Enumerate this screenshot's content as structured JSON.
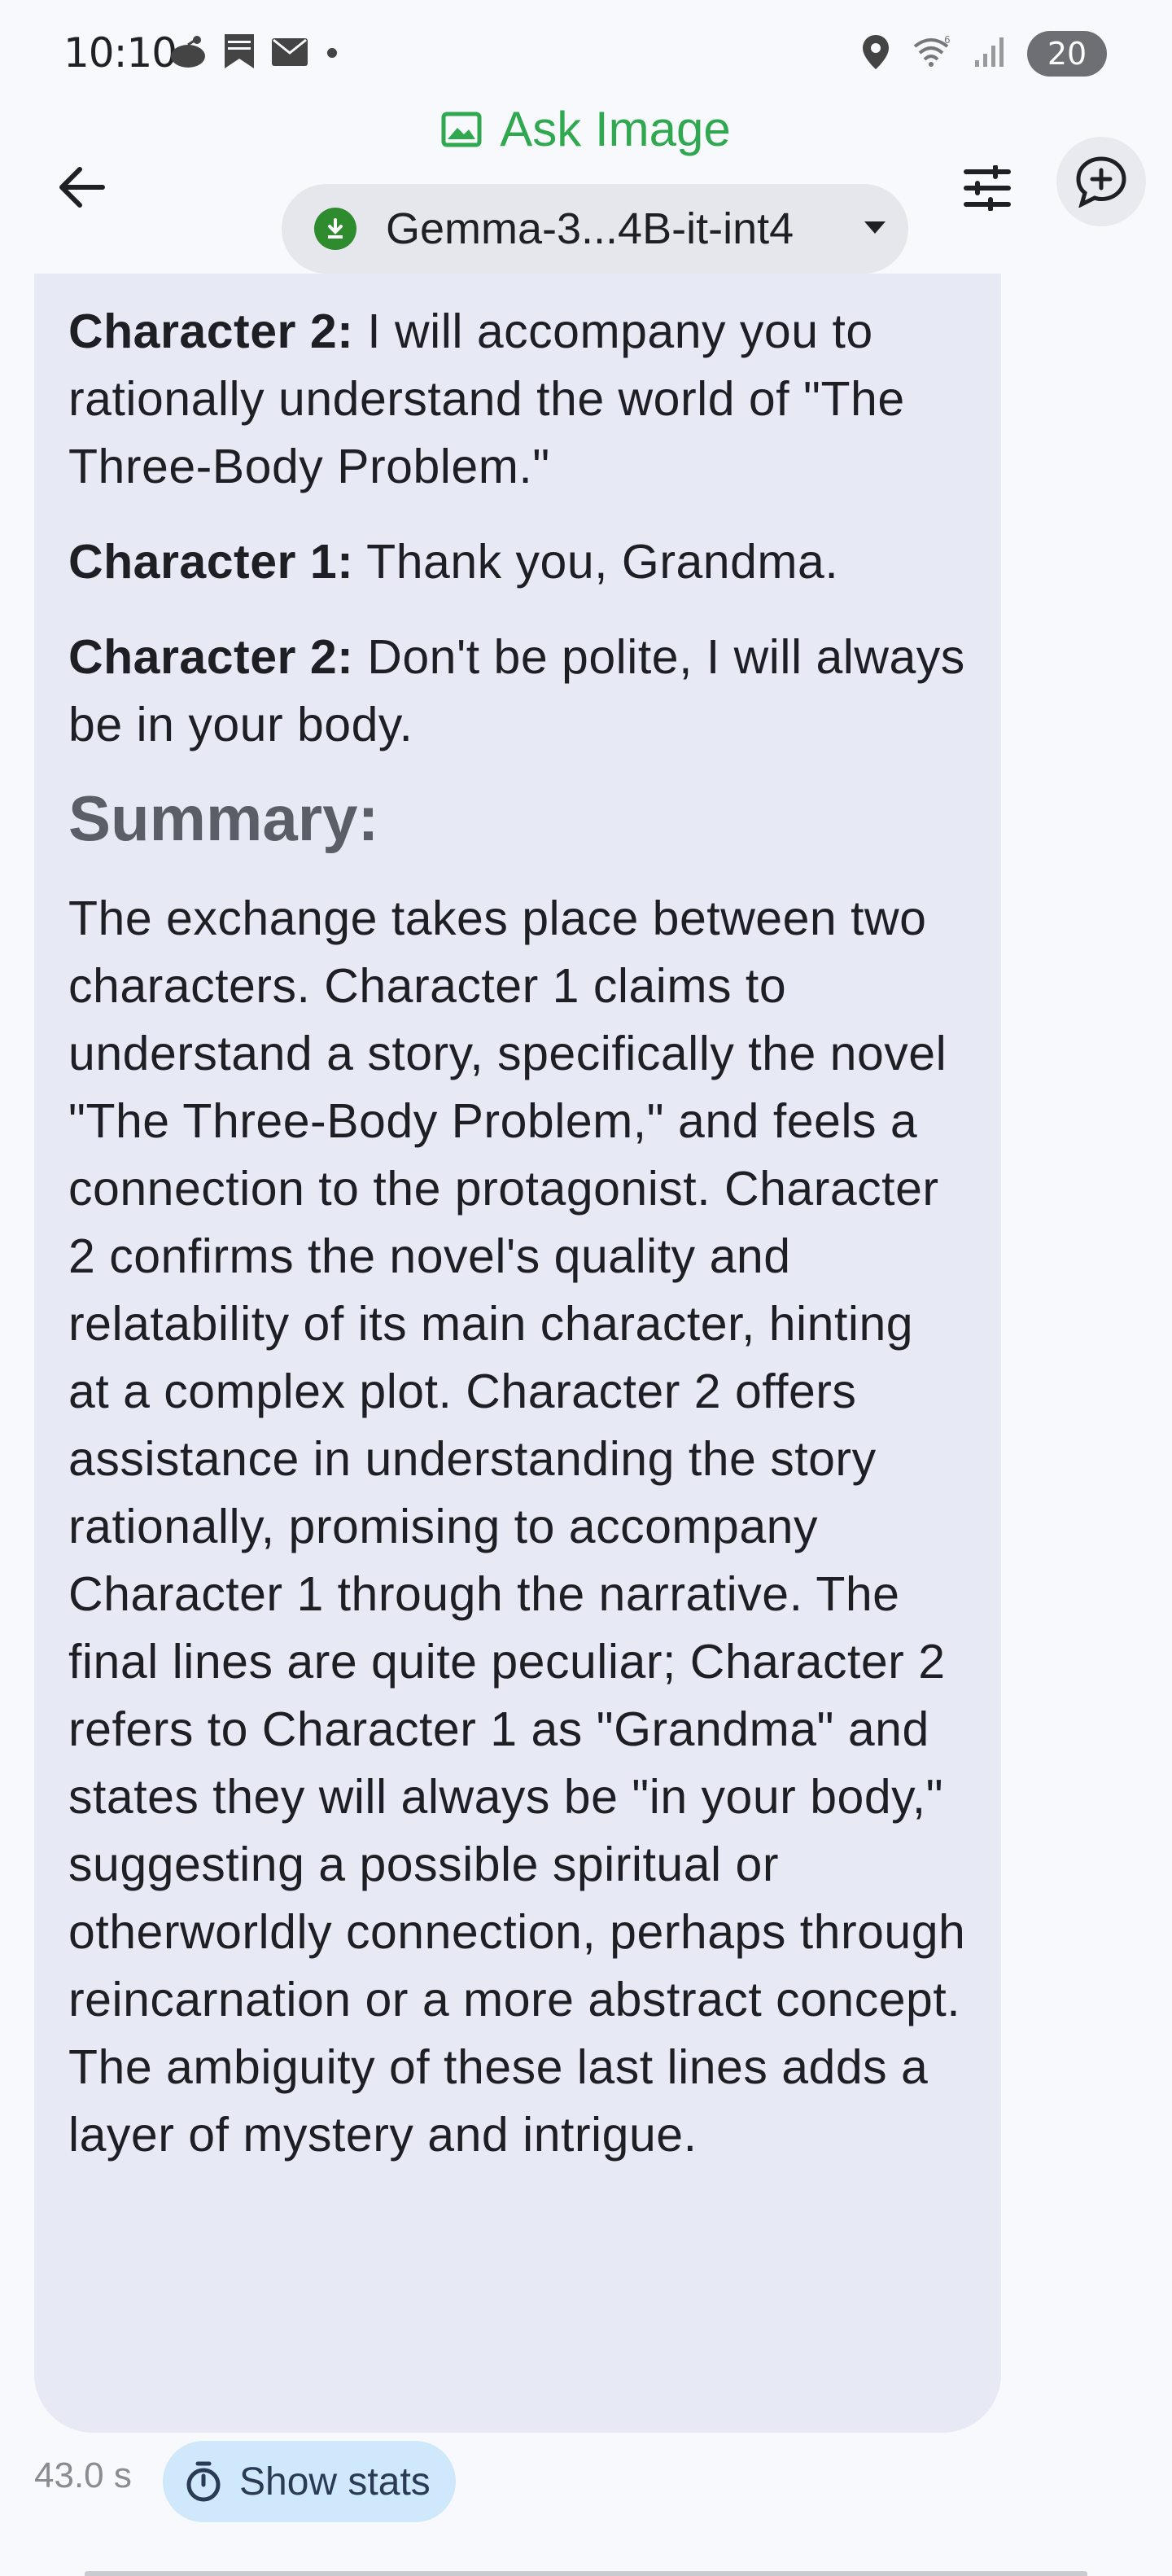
{
  "status_bar": {
    "time": "10:10",
    "battery": "20",
    "icons": [
      "reddit-icon",
      "bookmark-icon",
      "mail-icon",
      "dot-icon",
      "location-icon",
      "wifi-icon",
      "signal-icon"
    ]
  },
  "app_bar": {
    "title": "Ask Image",
    "model": "Gemma-3...4B-it-int4",
    "accent_color": "#2fa84f"
  },
  "message": {
    "lines": [
      {
        "speaker": "Character 2:",
        "text": " I will accompany you to rationally understand the world of \"The Three-Body Problem.\""
      },
      {
        "speaker": "Character 1:",
        "text": " Thank you, Grandma."
      },
      {
        "speaker": "Character 2:",
        "text": " Don't be polite, I will always be in your body."
      }
    ],
    "summary_heading": "Summary:",
    "summary_text": "The exchange takes place between two characters. Character 1 claims to understand a story, specifically the novel \"The Three-Body Problem,\" and feels a connection to the protagonist.  Character 2 confirms the novel's quality and relatability of its main character, hinting at a complex plot.  Character 2 offers assistance in understanding the story rationally, promising to accompany Character 1 through the narrative. The final lines are quite peculiar; Character 2 refers to Character 1 as \"Grandma\" and states they will always be \"in your body,\" suggesting a possible spiritual or otherworldly connection, perhaps through reincarnation or a more abstract concept. The ambiguity of these last lines adds a layer of mystery and intrigue."
  },
  "footer": {
    "latency": "43.0 s",
    "show_stats_label": "Show stats"
  }
}
